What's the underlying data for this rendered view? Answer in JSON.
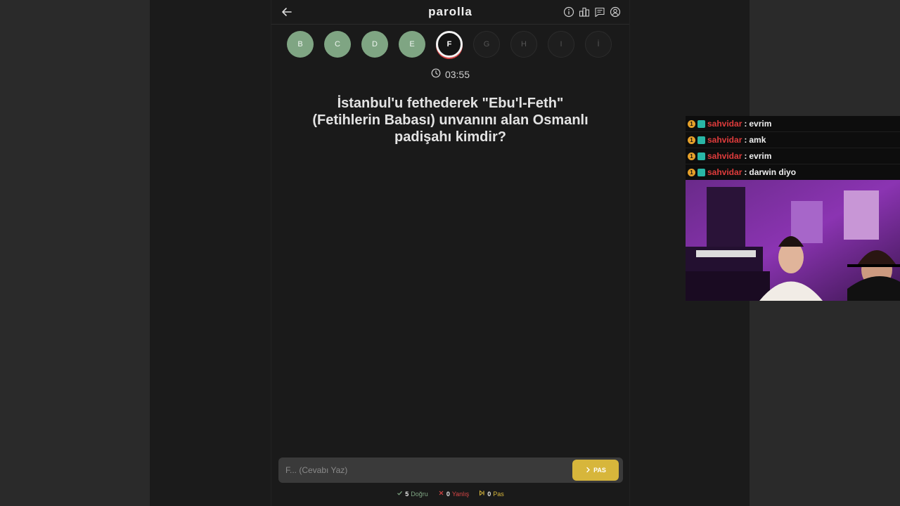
{
  "app": {
    "logo": "parolla",
    "icons": [
      "info-icon",
      "leaderboard-icon",
      "chat-icon",
      "user-icon"
    ],
    "letters": [
      {
        "letter": "B",
        "state": "done"
      },
      {
        "letter": "C",
        "state": "done"
      },
      {
        "letter": "D",
        "state": "done"
      },
      {
        "letter": "E",
        "state": "done"
      },
      {
        "letter": "F",
        "state": "current"
      },
      {
        "letter": "G",
        "state": "todo"
      },
      {
        "letter": "H",
        "state": "todo"
      },
      {
        "letter": "I",
        "state": "todo"
      },
      {
        "letter": "İ",
        "state": "todo"
      }
    ],
    "timer": "03:55",
    "question": "İstanbul'u fethederek \"Ebu'l-Feth\" (Fetihlerin Babası) unvanını alan Osmanlı padişahı kimdir?",
    "answer": {
      "placeholder": "F... (Cevabı Yaz)",
      "value": ""
    },
    "pas_label": "PAS",
    "stats": {
      "correct_count": "5",
      "correct_label": "Doğru",
      "wrong_count": "0",
      "wrong_label": "Yanlış",
      "pass_count": "0",
      "pass_label": "Pas"
    }
  },
  "chat": {
    "messages": [
      {
        "user": "sahvidar",
        "text": "evrim"
      },
      {
        "user": "sahvidar",
        "text": "amk"
      },
      {
        "user": "sahvidar",
        "text": "evrim"
      },
      {
        "user": "sahvidar",
        "text": "darwin diyo"
      }
    ]
  },
  "colors": {
    "done": "#7fa583",
    "current_ring": "#f2f2f2",
    "accent_red": "#d84545",
    "pas_button": "#d7b63b",
    "correct": "#7fa583",
    "wrong": "#d84545",
    "pass": "#d7b63b",
    "chat_user": "#e03c3c"
  }
}
